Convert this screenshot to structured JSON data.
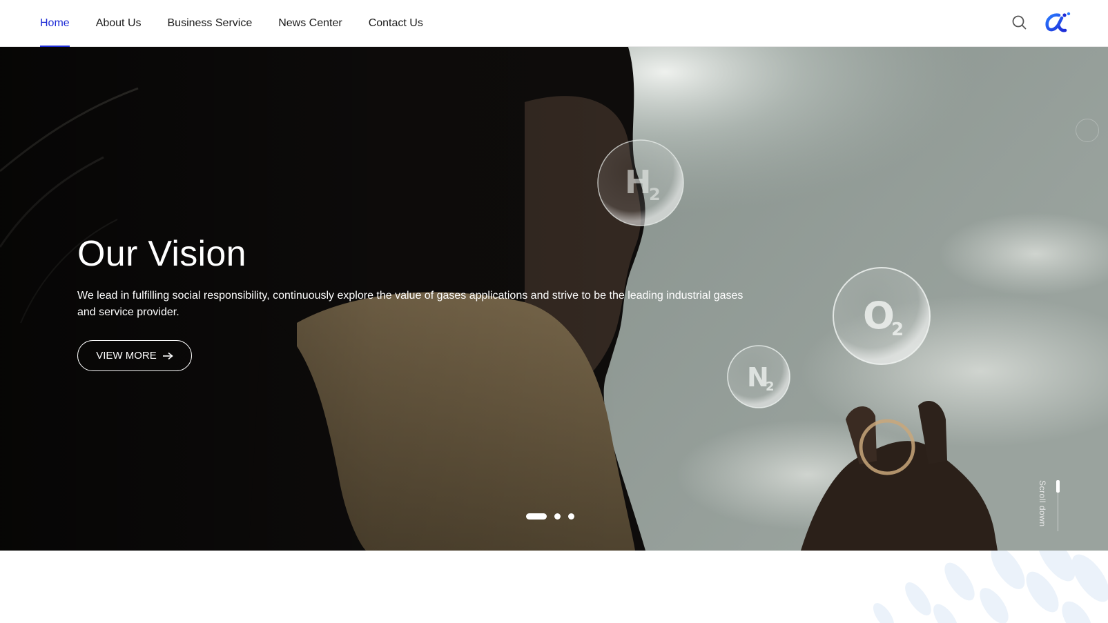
{
  "nav": {
    "items": [
      {
        "label": "Home",
        "active": true
      },
      {
        "label": "About Us",
        "active": false
      },
      {
        "label": "Business Service",
        "active": false
      },
      {
        "label": "News Center",
        "active": false
      },
      {
        "label": "Contact Us",
        "active": false
      }
    ],
    "search_icon": "search-icon",
    "logo_icon": "brand-logo-icon"
  },
  "hero": {
    "title": "Our Vision",
    "description": "We lead in fulfilling social responsibility, continuously explore the value of gases applications and strive to be the leading industrial gases and service provider.",
    "button_label": "VIEW MORE",
    "button_icon": "arrow-right-icon",
    "bubbles": [
      {
        "symbol": "H",
        "sub": "2"
      },
      {
        "symbol": "O",
        "sub": "2"
      },
      {
        "symbol": "N",
        "sub": "2"
      }
    ],
    "slides_total": 3,
    "active_slide": 1,
    "scroll_label": "Scroll down"
  },
  "colors": {
    "accent": "#1d2bd6",
    "nav_text": "#1a1a1a",
    "hero_text": "#ffffff"
  }
}
